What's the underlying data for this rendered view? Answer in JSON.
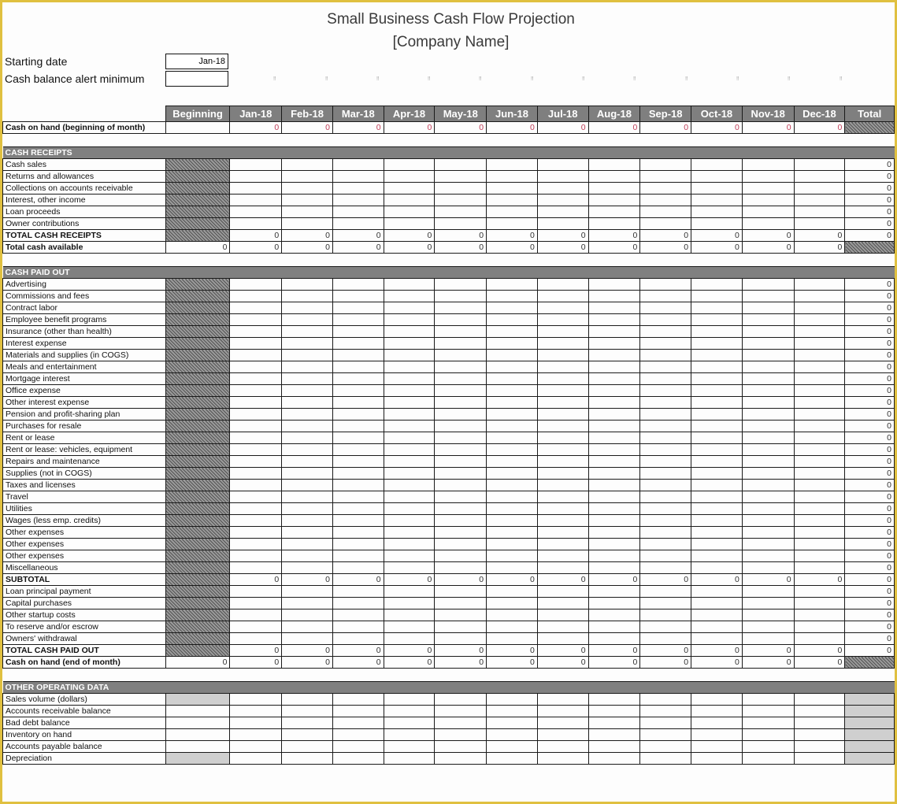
{
  "document": {
    "title": "Small Business Cash Flow Projection",
    "subtitle": "[Company Name]"
  },
  "settings": {
    "starting_date_label": "Starting date",
    "starting_date_value": "Jan-18",
    "alert_minimum_label": "Cash balance alert minimum",
    "alert_minimum_value": "",
    "alert_marker": "‼"
  },
  "columns": [
    "Beginning",
    "Jan-18",
    "Feb-18",
    "Mar-18",
    "Apr-18",
    "May-18",
    "Jun-18",
    "Jul-18",
    "Aug-18",
    "Sep-18",
    "Oct-18",
    "Nov-18",
    "Dec-18",
    "Total"
  ],
  "cash_on_hand_begin": {
    "label": "Cash on hand (beginning of month)",
    "beginning": "",
    "months": [
      "0",
      "0",
      "0",
      "0",
      "0",
      "0",
      "0",
      "0",
      "0",
      "0",
      "0",
      "0"
    ]
  },
  "cash_receipts": {
    "header": "CASH RECEIPTS",
    "items": [
      {
        "label": "Cash sales",
        "total": "0"
      },
      {
        "label": "Returns and allowances",
        "total": "0"
      },
      {
        "label": "Collections on accounts receivable",
        "total": "0"
      },
      {
        "label": "Interest, other income",
        "total": "0"
      },
      {
        "label": "Loan proceeds",
        "total": "0"
      },
      {
        "label": "Owner contributions",
        "total": "0"
      }
    ],
    "total_row": {
      "label": "TOTAL CASH RECEIPTS",
      "months": [
        "0",
        "0",
        "0",
        "0",
        "0",
        "0",
        "0",
        "0",
        "0",
        "0",
        "0",
        "0"
      ],
      "total": "0"
    },
    "available_row": {
      "label": "Total cash available",
      "beginning": "0",
      "months": [
        "0",
        "0",
        "0",
        "0",
        "0",
        "0",
        "0",
        "0",
        "0",
        "0",
        "0",
        "0"
      ]
    }
  },
  "cash_paid_out": {
    "header": "CASH PAID OUT",
    "items": [
      {
        "label": "Advertising",
        "total": "0"
      },
      {
        "label": "Commissions and fees",
        "total": "0"
      },
      {
        "label": "Contract labor",
        "total": "0"
      },
      {
        "label": "Employee benefit programs",
        "total": "0"
      },
      {
        "label": "Insurance (other than health)",
        "total": "0"
      },
      {
        "label": "Interest expense",
        "total": "0"
      },
      {
        "label": "Materials and supplies (in COGS)",
        "total": "0"
      },
      {
        "label": "Meals and entertainment",
        "total": "0"
      },
      {
        "label": "Mortgage interest",
        "total": "0"
      },
      {
        "label": "Office expense",
        "total": "0"
      },
      {
        "label": "Other interest expense",
        "total": "0"
      },
      {
        "label": "Pension and profit-sharing plan",
        "total": "0"
      },
      {
        "label": "Purchases for resale",
        "total": "0"
      },
      {
        "label": "Rent or lease",
        "total": "0"
      },
      {
        "label": "Rent or lease: vehicles, equipment",
        "total": "0"
      },
      {
        "label": "Repairs and maintenance",
        "total": "0"
      },
      {
        "label": "Supplies (not in COGS)",
        "total": "0"
      },
      {
        "label": "Taxes and licenses",
        "total": "0"
      },
      {
        "label": "Travel",
        "total": "0"
      },
      {
        "label": "Utilities",
        "total": "0"
      },
      {
        "label": "Wages (less emp. credits)",
        "total": "0"
      },
      {
        "label": "Other expenses",
        "total": "0"
      },
      {
        "label": "Other expenses",
        "total": "0"
      },
      {
        "label": "Other expenses",
        "total": "0"
      },
      {
        "label": "Miscellaneous",
        "total": "0"
      }
    ],
    "subtotal_row": {
      "label": "SUBTOTAL",
      "months": [
        "0",
        "0",
        "0",
        "0",
        "0",
        "0",
        "0",
        "0",
        "0",
        "0",
        "0",
        "0"
      ],
      "total": "0"
    },
    "items2": [
      {
        "label": "Loan principal payment",
        "total": "0"
      },
      {
        "label": "Capital purchases",
        "total": "0"
      },
      {
        "label": "Other startup costs",
        "total": "0"
      },
      {
        "label": "To reserve and/or escrow",
        "total": "0"
      },
      {
        "label": "Owners' withdrawal",
        "total": "0"
      }
    ],
    "total_row": {
      "label": "TOTAL CASH PAID OUT",
      "months": [
        "0",
        "0",
        "0",
        "0",
        "0",
        "0",
        "0",
        "0",
        "0",
        "0",
        "0",
        "0"
      ],
      "total": "0"
    },
    "end_row": {
      "label": "Cash on hand (end of month)",
      "beginning": "0",
      "months": [
        "0",
        "0",
        "0",
        "0",
        "0",
        "0",
        "0",
        "0",
        "0",
        "0",
        "0",
        "0"
      ]
    }
  },
  "other_operating": {
    "header": "OTHER OPERATING DATA",
    "items": [
      {
        "label": "Sales volume (dollars)",
        "beginning_shaded": true
      },
      {
        "label": "Accounts receivable balance",
        "beginning_shaded": false
      },
      {
        "label": "Bad debt balance",
        "beginning_shaded": false
      },
      {
        "label": "Inventory on hand",
        "beginning_shaded": false
      },
      {
        "label": "Accounts payable balance",
        "beginning_shaded": false
      },
      {
        "label": "Depreciation",
        "beginning_shaded": true
      }
    ]
  }
}
